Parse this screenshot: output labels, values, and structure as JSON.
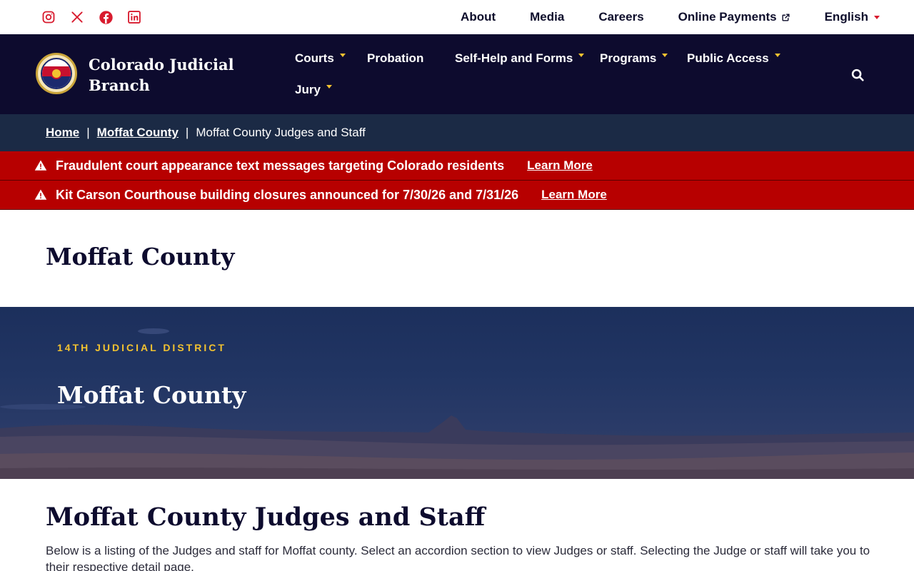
{
  "social": {
    "icons": [
      "instagram-icon",
      "x-twitter-icon",
      "facebook-icon",
      "linkedin-icon"
    ],
    "color": "#d81b2e"
  },
  "utility_nav": {
    "about": "About",
    "media": "Media",
    "careers": "Careers",
    "online_payments": "Online Payments",
    "language": "English"
  },
  "header": {
    "site_title": "Colorado Judicial Branch",
    "seal_text": "COLORADO COURTS",
    "nav": {
      "courts": "Courts",
      "probation": "Probation",
      "self_help": "Self-Help and Forms",
      "programs": "Programs",
      "public_access": "Public Access",
      "jury": "Jury"
    },
    "background": "#0d0b2e",
    "accent": "#f2c230"
  },
  "breadcrumb": {
    "home": "Home",
    "county": "Moffat County",
    "current": "Moffat County Judges and Staff",
    "separator": "|"
  },
  "alerts": [
    {
      "text": "Fraudulent court appearance text messages targeting Colorado residents",
      "link": "Learn More"
    },
    {
      "text": "Kit Carson Courthouse building closures announced for 7/30/26 and 7/31/26",
      "link": "Learn More"
    }
  ],
  "alert_color": "#b70000",
  "page": {
    "title": "Moffat County"
  },
  "hero": {
    "eyebrow": "14TH JUDICIAL DISTRICT",
    "title": "Moffat County"
  },
  "content": {
    "section_title": "Moffat County Judges and Staff",
    "intro": "Below is a listing of the Judges and staff for Moffat county. Select an accordion section to view Judges or staff. Selecting the Judge or staff will take you to their respective detail page."
  }
}
